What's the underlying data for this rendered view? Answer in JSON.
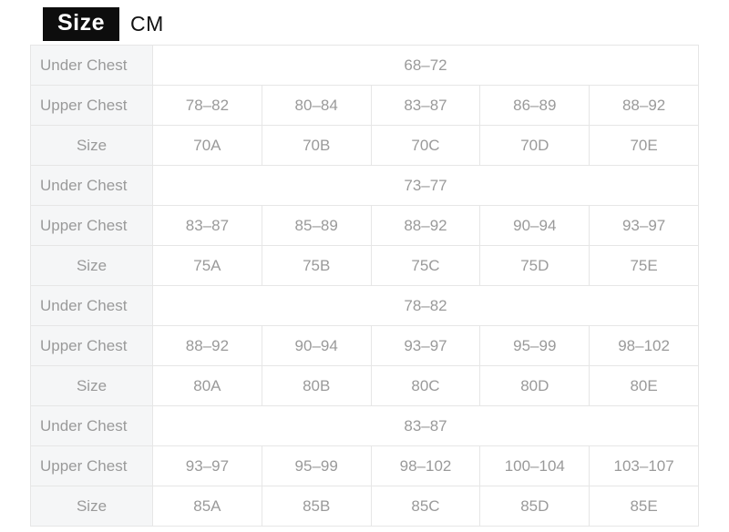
{
  "header": {
    "badge_label": "Size",
    "unit_label": "CM",
    "badge_bg_color": "#0d0d0d",
    "badge_text_color": "#ffffff",
    "unit_text_color": "#111111"
  },
  "table": {
    "label_column_bg": "#f5f6f7",
    "value_text_color": "#9a9a9a",
    "label_text_color": "#111111",
    "border_color": "#e6e6e6",
    "column_count": 5,
    "labels": {
      "under_chest": "Under Chest",
      "upper_chest": "Upper Chest",
      "size": "Size"
    },
    "blocks": [
      {
        "under_chest": "68–72",
        "upper_chest": [
          "78–82",
          "80–84",
          "83–87",
          "86–89",
          "88–92"
        ],
        "sizes": [
          "70A",
          "70B",
          "70C",
          "70D",
          "70E"
        ]
      },
      {
        "under_chest": "73–77",
        "upper_chest": [
          "83–87",
          "85–89",
          "88–92",
          "90–94",
          "93–97"
        ],
        "sizes": [
          "75A",
          "75B",
          "75C",
          "75D",
          "75E"
        ]
      },
      {
        "under_chest": "78–82",
        "upper_chest": [
          "88–92",
          "90–94",
          "93–97",
          "95–99",
          "98–102"
        ],
        "sizes": [
          "80A",
          "80B",
          "80C",
          "80D",
          "80E"
        ]
      },
      {
        "under_chest": "83–87",
        "upper_chest": [
          "93–97",
          "95–99",
          "98–102",
          "100–104",
          "103–107"
        ],
        "sizes": [
          "85A",
          "85B",
          "85C",
          "85D",
          "85E"
        ]
      }
    ]
  }
}
